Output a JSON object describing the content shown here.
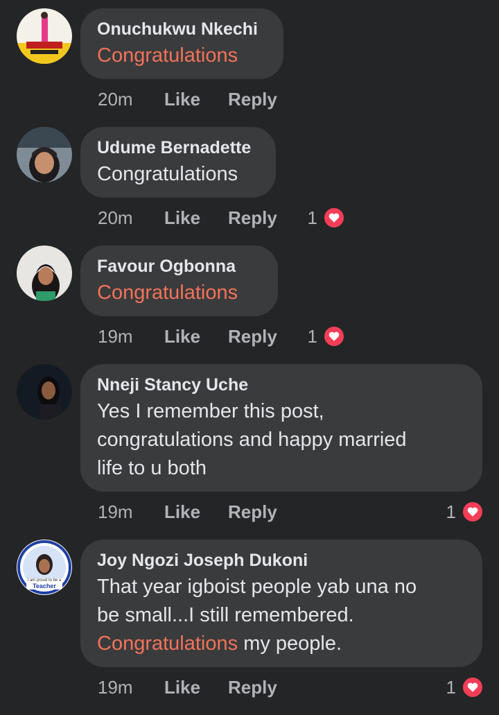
{
  "comments": [
    {
      "author": "Onuchukwu Nkechi",
      "text": "Congratulations",
      "time": "20m",
      "like_label": "Like",
      "reply_label": "Reply",
      "reaction_count": "",
      "reaction_icon": "heart-icon",
      "highlight_color": "#f3725a"
    },
    {
      "author": "Udume Bernadette",
      "text": "Congratulations",
      "time": "20m",
      "like_label": "Like",
      "reply_label": "Reply",
      "reaction_count": "1",
      "reaction_icon": "heart-icon"
    },
    {
      "author": "Favour Ogbonna",
      "text": "Congratulations",
      "time": "19m",
      "like_label": "Like",
      "reply_label": "Reply",
      "reaction_count": "1",
      "reaction_icon": "heart-icon",
      "highlight_color": "#f3725a"
    },
    {
      "author": "Nneji Stancy Uche",
      "text_lines": [
        "Yes I remember this post,",
        "congratulations and happy married",
        "life to u both"
      ],
      "time": "19m",
      "like_label": "Like",
      "reply_label": "Reply",
      "reaction_count": "1",
      "reaction_icon": "heart-icon"
    },
    {
      "author": "Joy Ngozi Joseph Dukoni",
      "text_lines": [
        "That year igboist people yab una no",
        "be small...I still remembered."
      ],
      "text_highlight": "Congratulations",
      "text_tail": " my people.",
      "avatar_caption": "Teacher",
      "time": "19m",
      "like_label": "Like",
      "reply_label": "Reply",
      "reaction_count": "1",
      "reaction_icon": "heart-icon"
    }
  ],
  "colors": {
    "background": "#242526",
    "bubble": "#3a3b3c",
    "text": "#e4e6eb",
    "secondary_text": "#b0b3b8",
    "highlight": "#f3725a",
    "heart": "#f33e58"
  }
}
